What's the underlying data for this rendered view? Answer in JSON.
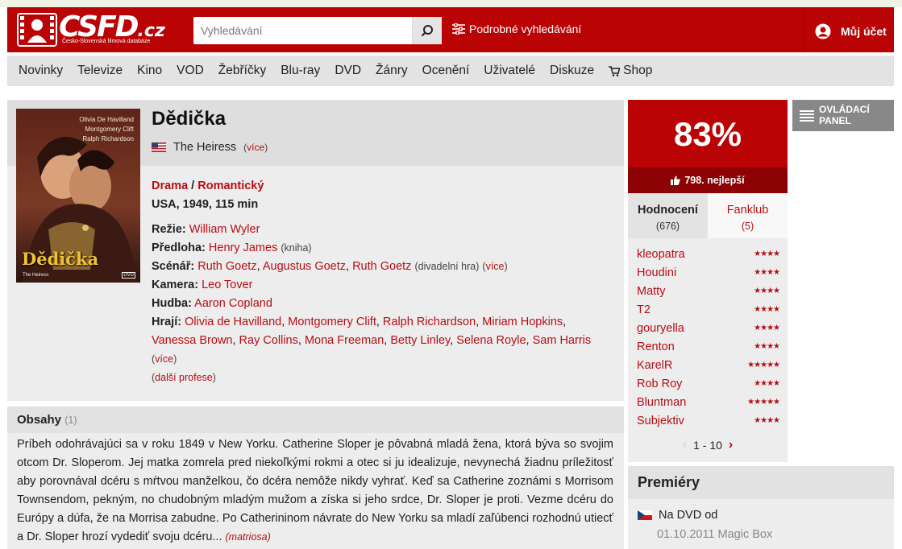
{
  "header": {
    "logo_text": "CSFD",
    "logo_domain": ".cz",
    "logo_subtitle": "Česko-Slovenská filmová databáze",
    "search_placeholder": "Vyhledávání",
    "advanced_search_label": "Podrobné vyhledávání",
    "account_label": "Můj účet"
  },
  "nav": {
    "items": [
      "Novinky",
      "Televize",
      "Kino",
      "VOD",
      "Žebříčky",
      "Blu-ray",
      "DVD",
      "Žánry",
      "Ocenění",
      "Uživatelé",
      "Diskuze"
    ],
    "shop_label": "Shop"
  },
  "film": {
    "title": "Dědička",
    "original_title": "The Heiress",
    "more_label": "více",
    "genre_1": "Drama",
    "genre_2": "Romantický",
    "genre_separator": " / ",
    "origin": "USA, 1949, 115 min",
    "poster": {
      "cast_1": "Olivia De Havilland",
      "cast_2": "Montgomery Clift",
      "cast_3": "Ralph Richardson",
      "title": "Dědička",
      "subtitle": "The Heiress",
      "badge": "DVD"
    },
    "directing_label": "Režie:",
    "director": "William Wyler",
    "source_label": "Předloha:",
    "source_author": "Henry James",
    "source_note": "(kniha)",
    "screenplay_label": "Scénář:",
    "writer_1": "Ruth Goetz",
    "writer_2": "Augustus Goetz",
    "writer_3": "Ruth Goetz",
    "writer_note": "(divadelní hra)",
    "camera_label": "Kamera:",
    "camera": "Leo Tover",
    "music_label": "Hudba:",
    "music": "Aaron Copland",
    "cast_label": "Hrají:",
    "cast": [
      "Olivia de Havilland",
      "Montgomery Clift",
      "Ralph Richardson",
      "Miriam Hopkins",
      "Vanessa Brown",
      "Ray Collins",
      "Mona Freeman",
      "Betty Linley",
      "Selena Royle",
      "Sam Harris"
    ],
    "other_professions": "další profese"
  },
  "plot": {
    "heading": "Obsahy",
    "count": "(1)",
    "text": "Príbeh odohrávajúci sa v roku 1849 v New Yorku. Catherine Sloper je pôvabná mladá žena, ktorá býva so svojim otcom Dr. Sloperom. Jej matka zomrela pred niekoľkými rokmi a otec si ju idealizuje, nevynechá žiadnu príležitosť aby porovnával dcéru s mŕtvou manželkou, čo dcéra nemôže nikdy vyhrať. Keď sa Catherine zoznámi s Morrisom Townsendom, pekným, no chudobným mladým mužom a získa si jeho srdce, Dr. Sloper je proti. Vezme dcéru do Európy a dúfa, že na Morrisa zabudne. Po Catherininom návrate do New Yorku sa mladí zaľúbenci rozhodnú utiecť a Dr. Sloper hrozí vydediť svoju dcéru...",
    "author": "(matriosa)"
  },
  "rating": {
    "percent": "83%",
    "rank": "798. nejlepší"
  },
  "tabs": {
    "ratings_label": "Hodnocení",
    "ratings_count": "(676)",
    "fanclub_label": "Fanklub",
    "fanclub_count": "(5)"
  },
  "ratings": [
    {
      "user": "kleopatra",
      "stars": 4
    },
    {
      "user": "Houdini",
      "stars": 4
    },
    {
      "user": "Matty",
      "stars": 4
    },
    {
      "user": "T2",
      "stars": 4
    },
    {
      "user": "gouryella",
      "stars": 4
    },
    {
      "user": "Renton",
      "stars": 4
    },
    {
      "user": "KarelR",
      "stars": 5
    },
    {
      "user": "Rob Roy",
      "stars": 4
    },
    {
      "user": "Bluntman",
      "stars": 5
    },
    {
      "user": "Subjektiv",
      "stars": 4
    }
  ],
  "pager": "1 - 10",
  "control_panel": "OVLÁDACÍ PANEL",
  "premieres": {
    "heading": "Premiéry",
    "item_label": "Na DVD od",
    "item_detail": "01.10.2011 Magic Box"
  },
  "colors": {
    "brand_red": "#ba0305",
    "dark_red": "#8c0103",
    "link_red": "#b80d14"
  }
}
